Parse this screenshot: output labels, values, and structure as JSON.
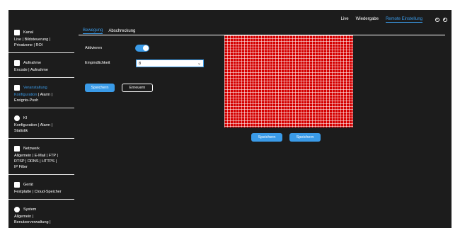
{
  "topnav": {
    "items": [
      "Live",
      "Wiedergabe",
      "Remote Einstellung"
    ],
    "active": "Remote Einstellung",
    "icons": [
      "info-icon",
      "power-icon"
    ]
  },
  "sidebar": [
    {
      "title": "Kanal",
      "icon": "camera-icon",
      "links": [
        "Live | Bildsteuerung |",
        "Privatzone | ROI"
      ]
    },
    {
      "title": "Aufnahme",
      "icon": "record-icon",
      "links": [
        "Encode | Aufnahme"
      ]
    },
    {
      "title": "Veranstaltung",
      "icon": "event-icon",
      "active": true,
      "links": [
        "Konfiguration",
        " | Alarm |",
        "Ereignis-Push"
      ]
    },
    {
      "title": "KI",
      "icon": "ai-icon",
      "links": [
        "Konfiguration | Alarm |",
        "Statistik"
      ]
    },
    {
      "title": "Netzwerk",
      "icon": "network-icon",
      "links": [
        "Allgemein | E-Mail | FTP |",
        "RTSP | DDNS | HTTPS |",
        "IP Filter"
      ]
    },
    {
      "title": "Gerät",
      "icon": "device-icon",
      "links": [
        "Festplatte | Cloud-Speicher"
      ]
    },
    {
      "title": "System",
      "icon": "system-icon",
      "links": [
        "Allgemein |",
        "Benutzerverwaltung |"
      ]
    }
  ],
  "tabs": [
    "Bewegung",
    "Abschreckung"
  ],
  "form": {
    "enable_label": "Aktivieren",
    "sensitivity_label": "Empindlichkeit",
    "sensitivity_value": "8",
    "save_label": "Speichern",
    "refresh_label": "Erneuern"
  },
  "grid": {
    "save_label_1": "Speichern",
    "save_label_2": "Speichern"
  },
  "colors": {
    "accent": "#3a9be8",
    "grid": "#d40000",
    "bg": "#1c1c1c"
  }
}
